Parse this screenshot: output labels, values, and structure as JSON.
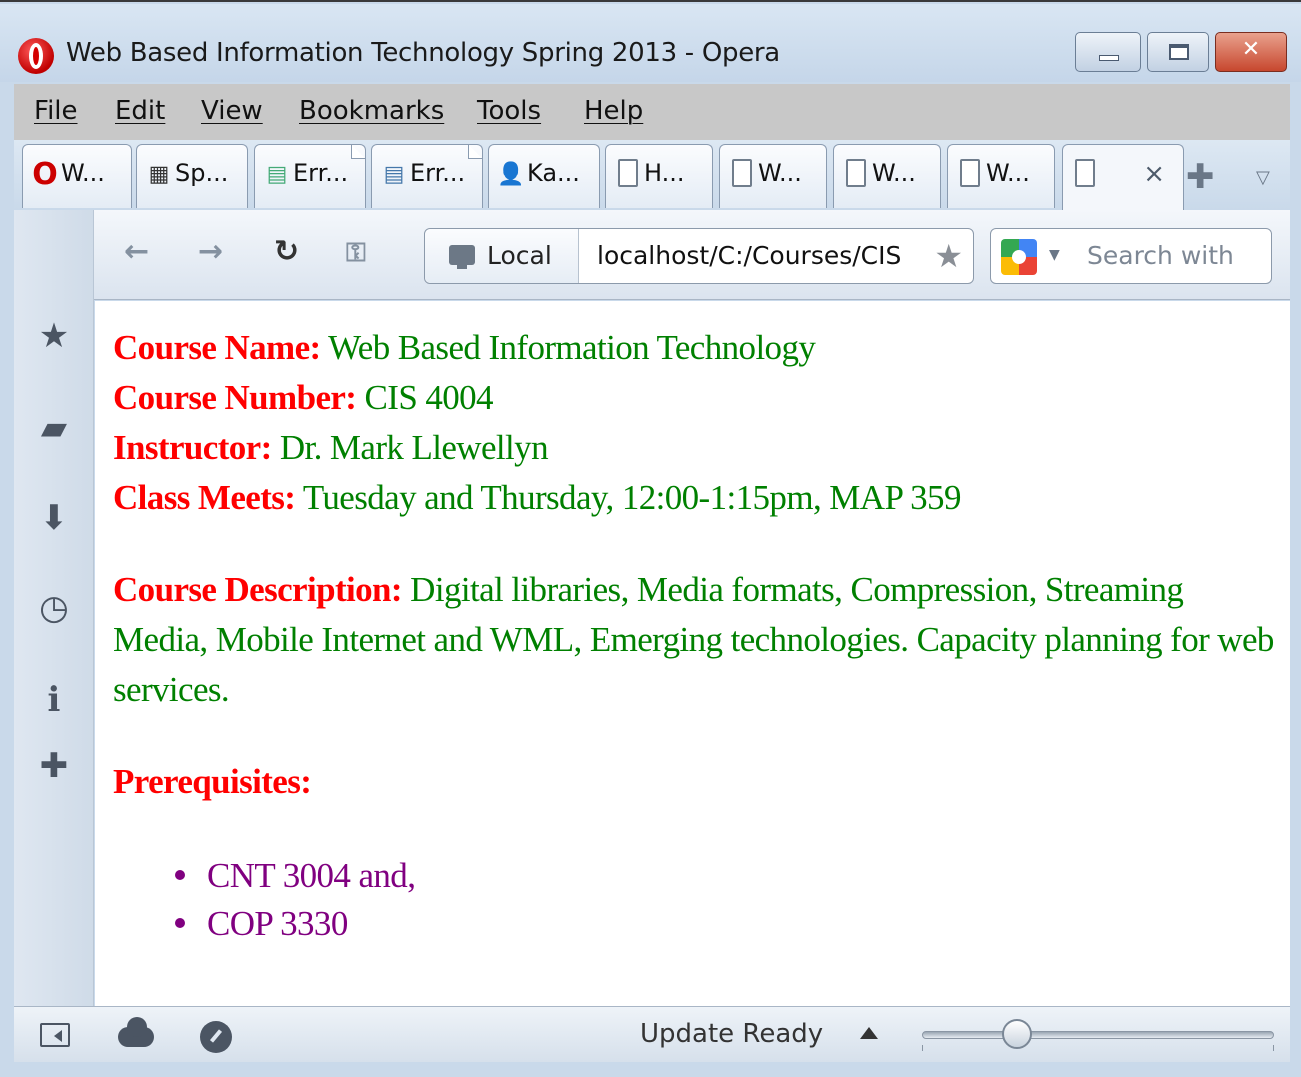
{
  "window": {
    "title": "Web Based Information Technology Spring 2013 - Opera"
  },
  "menu": [
    "File",
    "Edit",
    "View",
    "Bookmarks",
    "Tools",
    "Help"
  ],
  "tabs": [
    {
      "label": "W...",
      "icon": "opera-icon"
    },
    {
      "label": "Sp...",
      "icon": "speed-dial-icon"
    },
    {
      "label": "Err...",
      "icon": "error-console-icon"
    },
    {
      "label": "Err...",
      "icon": "error-console-icon"
    },
    {
      "label": "Ka...",
      "icon": "avatar-icon"
    },
    {
      "label": "H...",
      "icon": "page-icon"
    },
    {
      "label": "W...",
      "icon": "page-icon"
    },
    {
      "label": "W...",
      "icon": "page-icon"
    },
    {
      "label": "W...",
      "icon": "page-icon"
    },
    {
      "label": "",
      "icon": "page-icon",
      "active": true
    }
  ],
  "navbar": {
    "address_scope": "Local",
    "url": "localhost/C:/Courses/CIS",
    "search_placeholder": "Search with"
  },
  "page": {
    "course_name_label": "Course Name:",
    "course_name_value": "Web Based Information Technology",
    "course_number_label": "Course Number:",
    "course_number_value": "CIS 4004",
    "instructor_label": "Instructor:",
    "instructor_value": "Dr. Mark Llewellyn",
    "class_meets_label": "Class Meets:",
    "class_meets_value": "Tuesday and Thursday, 12:00-1:15pm, MAP 359",
    "description_label": "Course Description:",
    "description_value": "Digital libraries, Media formats, Compression, Streaming Media, Mobile Internet and WML, Emerging technologies. Capacity planning for web services.",
    "prereq_label": "Prerequisites:",
    "prereq_items": [
      "CNT 3004 and,",
      "COP 3330"
    ]
  },
  "statusbar": {
    "update_text": "Update Ready",
    "zoom_level_fraction": 0.27
  },
  "colors": {
    "label_red": "#ff0000",
    "value_green": "#008000",
    "list_purple": "#800080"
  }
}
